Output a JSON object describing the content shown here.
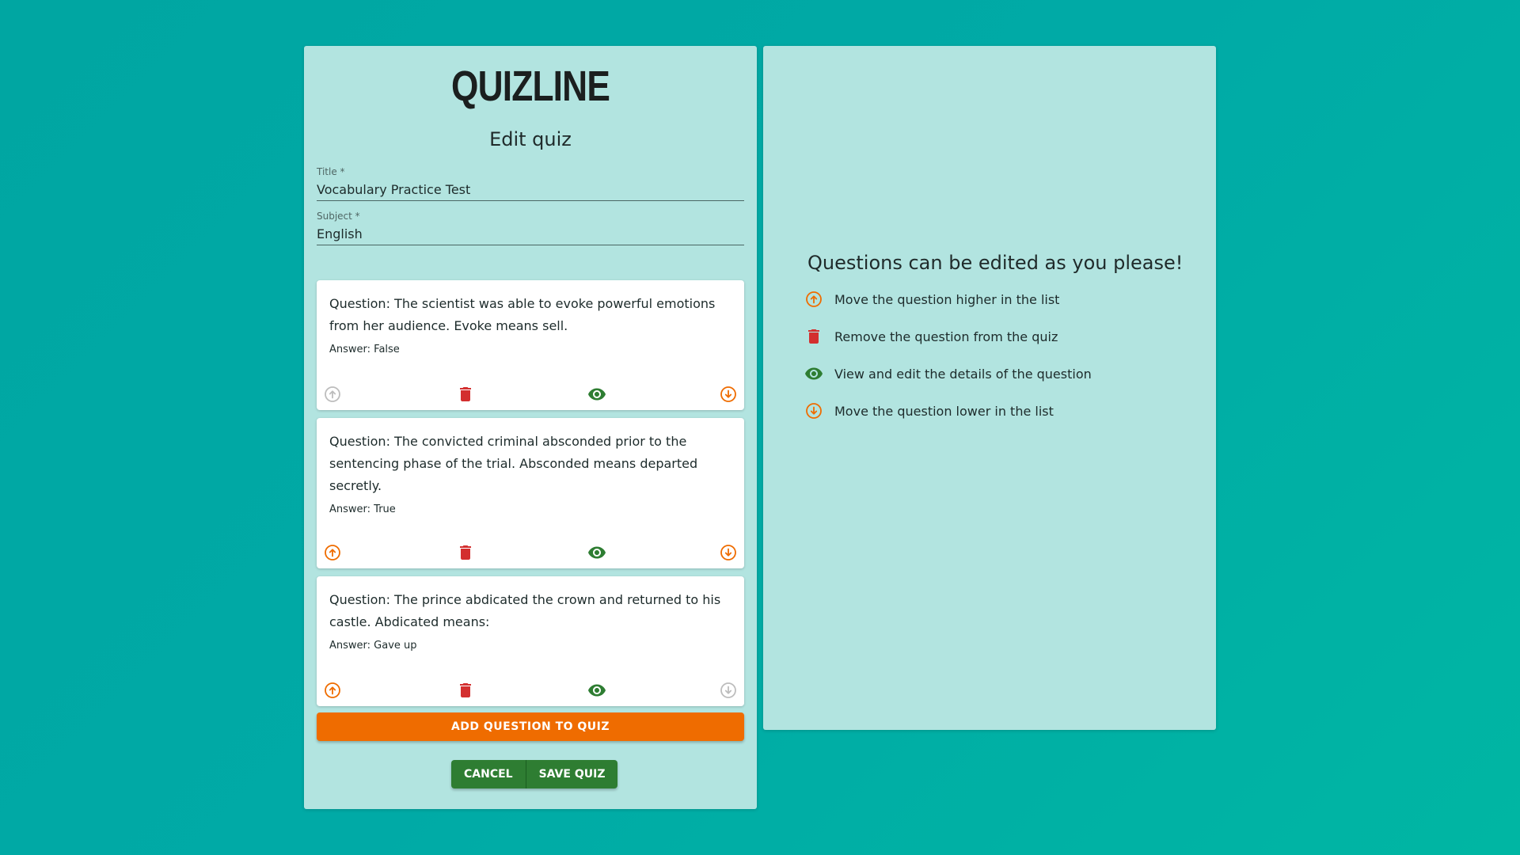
{
  "app": {
    "logo": "QUIZLINE",
    "heading": "Edit quiz"
  },
  "form": {
    "title": {
      "label": "Title *",
      "value": "Vocabulary Practice Test"
    },
    "subject": {
      "label": "Subject *",
      "value": "English"
    }
  },
  "questions": [
    {
      "question": "Question: The scientist was able to evoke powerful emotions from her audience. Evoke means sell.",
      "answer": "Answer: False",
      "can_move_up": false,
      "can_move_down": true
    },
    {
      "question": "Question: The convicted criminal absconded prior to the sentencing phase of the trial. Absconded means departed secretly.",
      "answer": "Answer: True",
      "can_move_up": true,
      "can_move_down": true
    },
    {
      "question": "Question: The prince abdicated the crown and returned to his castle. Abdicated means:",
      "answer": "Answer: Gave up",
      "can_move_up": true,
      "can_move_down": false
    }
  ],
  "buttons": {
    "add_question": "ADD QUESTION TO QUIZ",
    "cancel": "CANCEL",
    "save": "SAVE QUIZ"
  },
  "help": {
    "title": "Questions can be edited as you please!",
    "items": [
      {
        "icon": "arrow-circle-up-icon",
        "text": "Move the question higher in the list"
      },
      {
        "icon": "trash-icon",
        "text": "Remove the question from the quiz"
      },
      {
        "icon": "eye-icon",
        "text": "View and edit the details of the question"
      },
      {
        "icon": "arrow-circle-down-icon",
        "text": "Move the question lower in the list"
      }
    ]
  },
  "colors": {
    "orange": "#ef6c00",
    "red": "#d32f2f",
    "green": "#2e7d32",
    "disabled": "#9e9e9e",
    "panel": "#b2e4e0"
  }
}
